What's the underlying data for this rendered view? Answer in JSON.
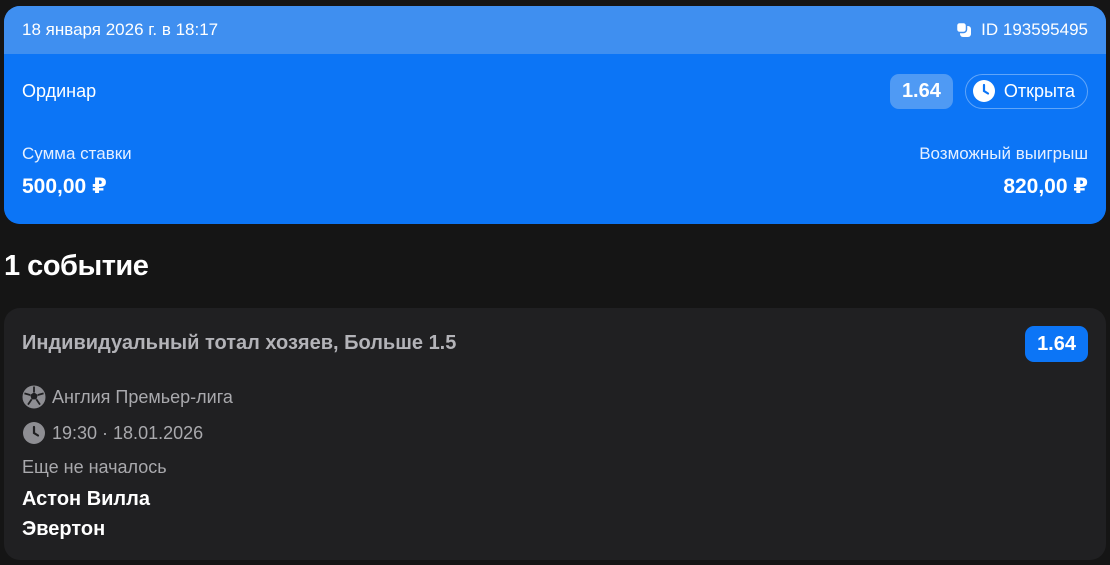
{
  "bet": {
    "datetime": "18 января 2026 г. в 18:17",
    "id_text": "ID 193595495",
    "type": "Ординар",
    "coefficient": "1.64",
    "status": "Открыта",
    "stake_label": "Сумма ставки",
    "stake_value": "500,00 ₽",
    "win_label": "Возможный выигрыш",
    "win_value": "820,00 ₽"
  },
  "events": {
    "heading": "1 событие",
    "items": [
      {
        "market": "Индивидуальный тотал хозяев, Больше 1.5",
        "coefficient": "1.64",
        "league": "Англия Премьер-лига",
        "time": "19:30 · 18.01.2026",
        "status": "Еще не началось",
        "team_home": "Астон Вилла",
        "team_away": "Эвертон",
        "sport_icon": "soccer-ball-icon"
      }
    ]
  },
  "colors": {
    "background": "#151515",
    "accent": "#0c75f6",
    "header_strip": "#3f8ff0",
    "card": "#202022"
  }
}
